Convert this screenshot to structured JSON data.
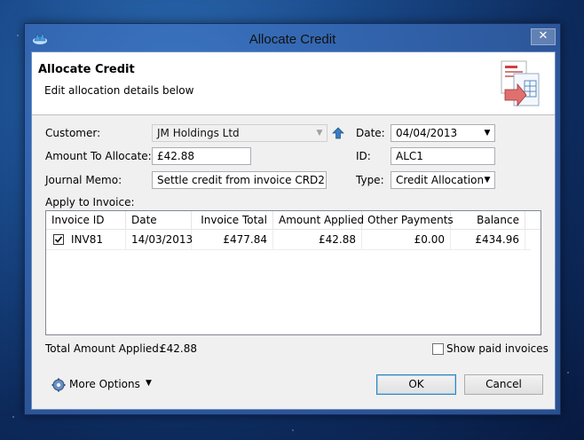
{
  "window": {
    "title": "Allocate Credit",
    "close_label": "✕"
  },
  "header": {
    "title": "Allocate Credit",
    "subtitle": "Edit allocation details below"
  },
  "form": {
    "customer_label": "Customer:",
    "customer_value": "JM Holdings Ltd",
    "amount_label": "Amount To Allocate:",
    "amount_value": "£42.88",
    "memo_label": "Journal Memo:",
    "memo_value": "Settle credit from invoice CRD2",
    "apply_label": "Apply to Invoice:",
    "date_label": "Date:",
    "date_value": "04/04/2013",
    "id_label": "ID:",
    "id_value": "ALC1",
    "type_label": "Type:",
    "type_value": "Credit Allocation"
  },
  "table": {
    "columns": [
      "Invoice ID",
      "Date",
      "Invoice Total",
      "Amount Applied",
      "Other Payments",
      "Balance"
    ],
    "rows": [
      {
        "checked": true,
        "invoice_id": "INV81",
        "date": "14/03/2013",
        "invoice_total": "£477.84",
        "amount_applied": "£42.88",
        "other_payments": "£0.00",
        "balance": "£434.96"
      }
    ]
  },
  "footer": {
    "total_label": "Total Amount Applied:",
    "total_value": "£42.88",
    "show_paid_label": "Show paid invoices",
    "show_paid_checked": false,
    "more_options_label": "More Options",
    "ok_label": "OK",
    "cancel_label": "Cancel"
  }
}
